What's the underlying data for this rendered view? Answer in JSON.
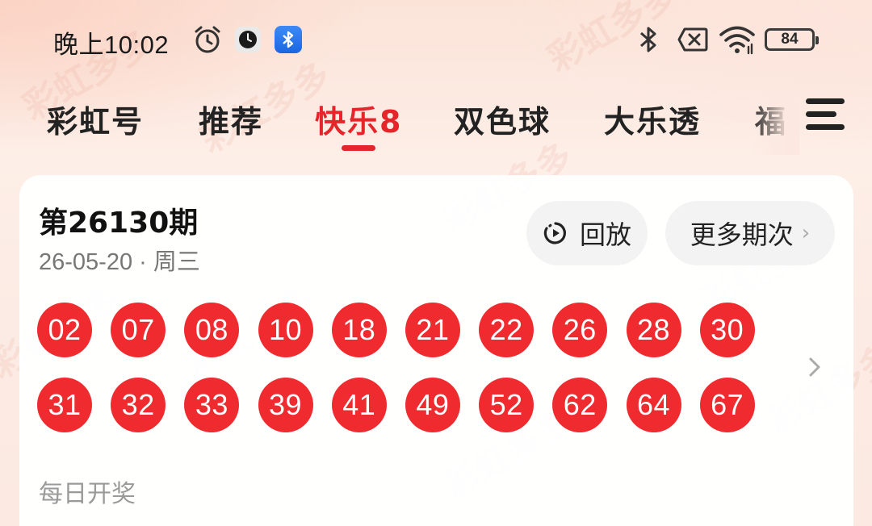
{
  "status_bar": {
    "time": "晚上10:02",
    "battery": "84",
    "icons": [
      "alarm-icon",
      "clock-app-icon",
      "bluetooth-app-icon",
      "bluetooth-icon",
      "no-sim-icon",
      "wifi-icon",
      "battery-icon"
    ]
  },
  "tabs": [
    {
      "label": "彩虹号",
      "active": false
    },
    {
      "label": "推荐",
      "active": false
    },
    {
      "label": "快乐8",
      "active": true
    },
    {
      "label": "双色球",
      "active": false
    },
    {
      "label": "大乐透",
      "active": false
    },
    {
      "label": "福",
      "active": false
    }
  ],
  "card": {
    "issue_title": "第26130期",
    "issue_date": "26-05-20 · 周三",
    "replay_label": "回放",
    "more_label": "更多期次",
    "numbers_row1": [
      "02",
      "07",
      "08",
      "10",
      "18",
      "21",
      "22",
      "26",
      "28",
      "30"
    ],
    "numbers_row2": [
      "31",
      "32",
      "33",
      "39",
      "41",
      "49",
      "52",
      "62",
      "64",
      "67"
    ],
    "schedule": "每日开奖"
  },
  "watermark_text": "彩虹多多",
  "colors": {
    "accent": "#e5252a",
    "ball": "#f02b2f"
  }
}
